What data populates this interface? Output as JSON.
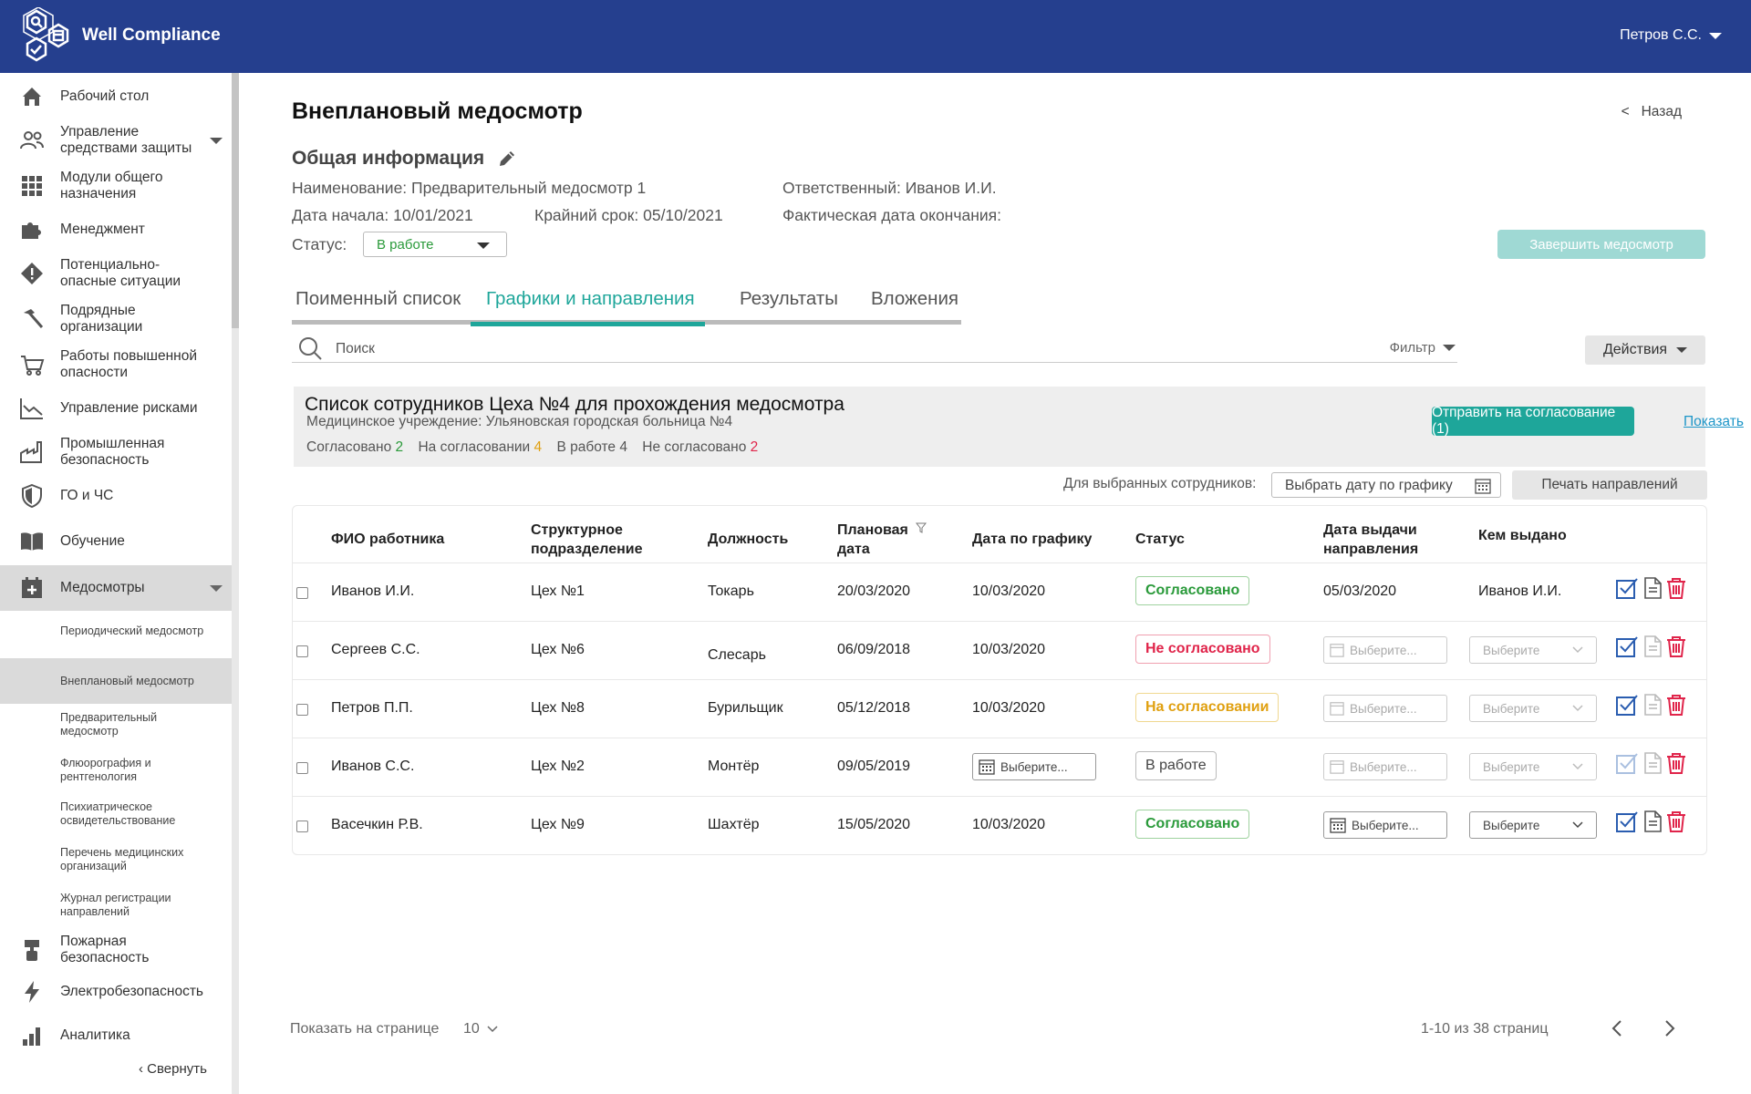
{
  "app": {
    "title": "Well Compliance",
    "user": "Петров С.С."
  },
  "sidebar": {
    "items": [
      {
        "label": "Рабочий стол"
      },
      {
        "label": "Управление средствами защиты"
      },
      {
        "label": "Модули общего назначения"
      },
      {
        "label": "Менеджмент"
      },
      {
        "label": "Потенциально-опасные ситуации"
      },
      {
        "label": "Подрядные организации"
      },
      {
        "label": "Работы повышенной опасности"
      },
      {
        "label": "Управление рисками"
      },
      {
        "label": "Промышленная безопасность"
      },
      {
        "label": "ГО и ЧС"
      },
      {
        "label": "Обучение"
      },
      {
        "label": "Медосмотры"
      },
      {
        "label": "Пожарная безопасность"
      },
      {
        "label": "Электробезопасность"
      },
      {
        "label": "Аналитика"
      }
    ],
    "subitems": [
      {
        "label": "Периодический медосмотр"
      },
      {
        "label": "Внеплановый медосмотр"
      },
      {
        "label": "Предварительный медосмотр"
      },
      {
        "label": "Флюорография и рентгенология"
      },
      {
        "label": "Психиатрическое освидетельствование"
      },
      {
        "label": "Перечень медицинских организаций"
      },
      {
        "label": "Журнал регистрации направлений"
      }
    ],
    "collapse": "Свернуть"
  },
  "page": {
    "title": "Внеплановый медосмотр",
    "back": "Назад",
    "section": "Общая информация",
    "name": "Наименование: Предварительный медосмотр 1",
    "start": "Дата начала: 10/01/2021",
    "deadline": "Крайний срок: 05/10/2021",
    "responsible": "Ответственный: Иванов И.И.",
    "actual_end": "Фактическая дата окончания:",
    "status_label": "Статус:",
    "status_value": "В работе",
    "finish_btn": "Завершить медосмотр"
  },
  "tabs": [
    "Поименный список",
    "Графики и направления",
    "Результаты",
    "Вложения"
  ],
  "search": {
    "placeholder": "Поиск",
    "filter": "Фильтр",
    "actions": "Действия"
  },
  "list": {
    "title": "Список сотрудников Цеха №4 для прохождения медосмотра",
    "subtitle": "Медицинское учреждение: Ульяновская городская больница №4",
    "agreed_label": "Согласовано",
    "agreed": "2",
    "pending_label": "На согласовании",
    "pending": "4",
    "work_label": "В работе",
    "work": "4",
    "rejected_label": "Не согласовано",
    "rejected": "2",
    "send_btn": "Отправить на согласование (1)",
    "show_link": "Показать"
  },
  "selected": {
    "label": "Для выбранных сотрудников:",
    "date_btn": "Выбрать дату по графику",
    "print_btn": "Печать направлений"
  },
  "table": {
    "headers": {
      "name": "ФИО работника",
      "unit": "Структурное подразделение",
      "position": "Должность",
      "planned": "Плановая дата",
      "scheduled": "Дата по графику",
      "status": "Статус",
      "issued_date": "Дата выдачи направления",
      "issued_by": "Кем выдано"
    },
    "placeholder_date": "Выберите...",
    "placeholder_select": "Выберите",
    "rows": [
      {
        "name": "Иванов И.И.",
        "unit": "Цех №1",
        "position": "Токарь",
        "planned": "20/03/2020",
        "scheduled": "10/03/2020",
        "status": "Согласовано",
        "issued_date": "05/03/2020",
        "issued_by": "Иванов И.И."
      },
      {
        "name": "Сергеев С.С.",
        "unit": "Цех №6",
        "position": "Слесарь",
        "planned": "06/09/2018",
        "scheduled": "10/03/2020",
        "status": "Не согласовано"
      },
      {
        "name": "Петров П.П.",
        "unit": "Цех №8",
        "position": "Бурильщик",
        "planned": "05/12/2018",
        "scheduled": "10/03/2020",
        "status": "На согласовании"
      },
      {
        "name": "Иванов С.С.",
        "unit": "Цех №2",
        "position": "Монтёр",
        "planned": "09/05/2019",
        "status": "В работе"
      },
      {
        "name": "Васечкин Р.В.",
        "unit": "Цех №9",
        "position": "Шахтёр",
        "planned": "15/05/2020",
        "scheduled": "10/03/2020",
        "status": "Согласовано"
      }
    ]
  },
  "pager": {
    "label": "Показать на странице",
    "size": "10",
    "info": "1-10 из 38 страниц"
  },
  "colors": {
    "brand": "#253f8e",
    "accent": "#1ea69a",
    "ok": "#2a9a3a",
    "pending": "#e0a010",
    "danger": "#e0244a"
  }
}
